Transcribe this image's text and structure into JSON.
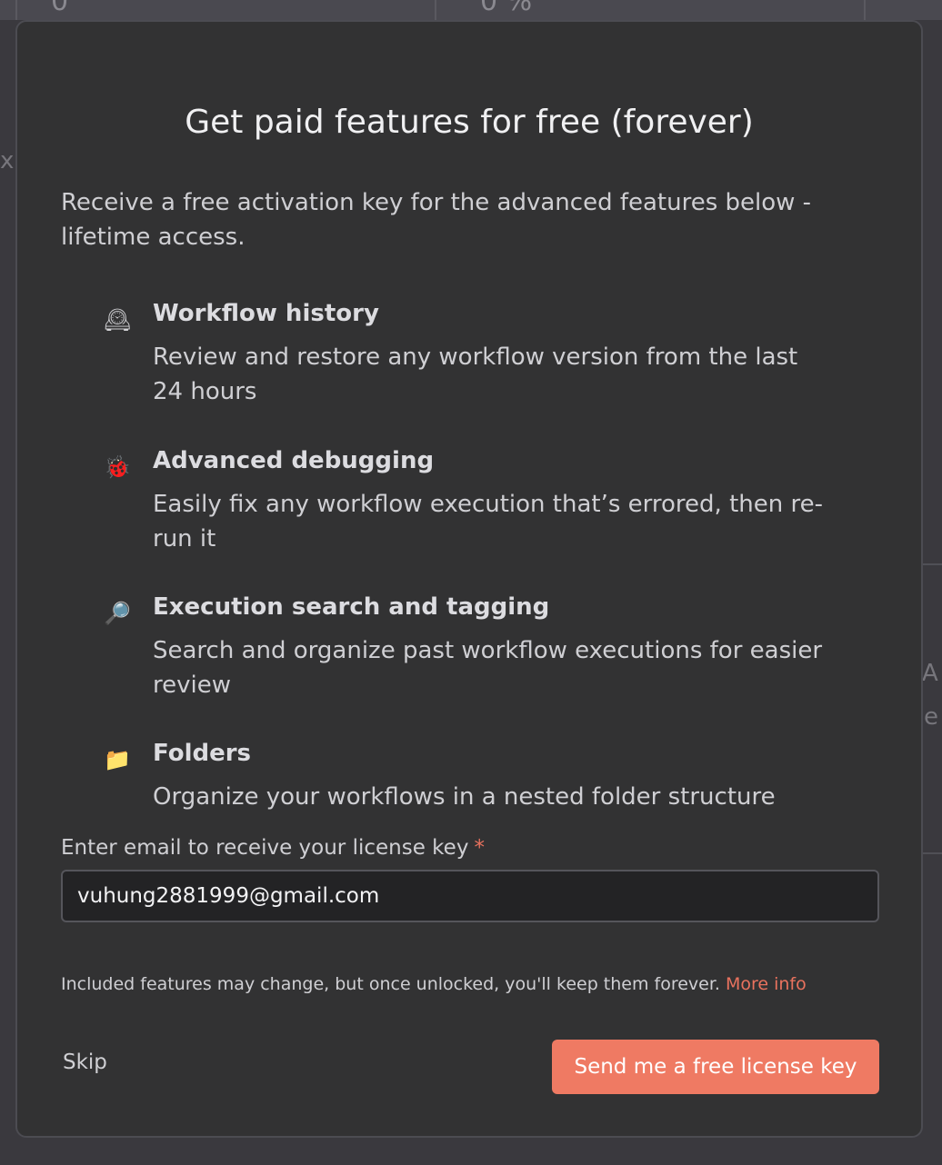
{
  "background": {
    "top_glyph_left": "0",
    "top_glyph_right": "0 %",
    "left_edge_char": "x",
    "right_edge_chars": [
      "A",
      "e"
    ]
  },
  "modal": {
    "title": "Get paid features for free (forever)",
    "intro": "Receive a free activation key for the advanced features below - lifetime access.",
    "features": [
      {
        "icon": "clock-icon",
        "icon_glyph": "🕰",
        "title": "Workflow history",
        "description": "Review and restore any workflow version from the last 24 hours"
      },
      {
        "icon": "ladybug-icon",
        "icon_glyph": "🐞",
        "title": "Advanced debugging",
        "description": "Easily fix any workflow execution that’s errored, then re-run it"
      },
      {
        "icon": "magnifier-icon",
        "icon_glyph": "🔎",
        "title": "Execution search and tagging",
        "description": "Search and organize past workflow executions for easier review"
      },
      {
        "icon": "folder-icon",
        "icon_glyph": "📁",
        "title": "Folders",
        "description": "Organize your workflows in a nested folder structure"
      }
    ],
    "email_label": "Enter email to receive your license key",
    "required_marker": "*",
    "email_value": "vuhung2881999@gmail.com",
    "disclaimer": "Included features may change, but once unlocked, you'll keep them forever.",
    "more_info_label": "More info",
    "skip_label": "Skip",
    "send_label": "Send me a free license key"
  },
  "colors": {
    "accent": "#ef7a63",
    "modal_bg": "#323233",
    "backdrop": "#3a393e"
  }
}
